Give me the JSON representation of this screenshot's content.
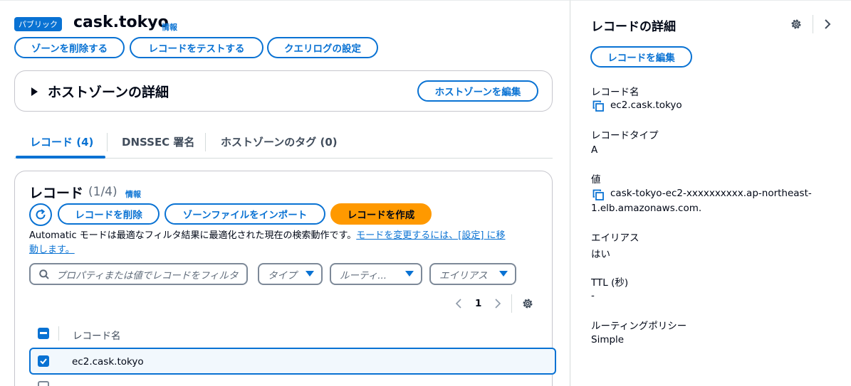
{
  "zone": {
    "badge": "パブリック",
    "name": "cask.tokyo",
    "info": "情報"
  },
  "actions": {
    "delete_zone": "ゾーンを削除する",
    "test_record": "レコードをテストする",
    "query_log": "クエリログの設定"
  },
  "hosted_zone_details": {
    "title": "ホストゾーンの詳細",
    "edit": "ホストゾーンを編集"
  },
  "tabs": [
    {
      "label": "レコード (4)"
    },
    {
      "label": "DNSSEC 署名"
    },
    {
      "label": "ホストゾーンのタグ (0)"
    }
  ],
  "records": {
    "title": "レコード",
    "count": "(1/4)",
    "info": "情報",
    "delete": "レコードを削除",
    "import": "ゾーンファイルをインポート",
    "create": "レコードを作成",
    "notice_text": "Automatic モードは最適なフィルタ結果に最適化された現在の検索動作です。",
    "notice_link_1": "モードを変更するには、[設定] に移",
    "notice_link_2": "動します。",
    "search_placeholder": "プロパティまたは値でレコードをフィルタ",
    "filter_type": "タイプ",
    "filter_routing": "ルーティ...",
    "filter_alias": "エイリアス",
    "page": "1",
    "column_name": "レコード名",
    "rows": [
      {
        "name": "ec2.cask.tokyo",
        "selected": true
      }
    ]
  },
  "details_panel": {
    "title": "レコードの詳細",
    "edit": "レコードを編集",
    "fields": [
      {
        "label": "レコード名",
        "value": "ec2.cask.tokyo"
      },
      {
        "label": "レコードタイプ",
        "value": "A"
      },
      {
        "label": "値",
        "value_1": "cask-tokyo-ec2-xxxxxxxxxx.ap-northeast-",
        "value_2": "1.elb.amazonaws.com."
      },
      {
        "label": "エイリアス",
        "value": "はい"
      },
      {
        "label": "TTL (秒)",
        "value": "-"
      },
      {
        "label": "ルーティングポリシー",
        "value": "Simple"
      }
    ]
  },
  "colors": {
    "accent": "#0972d3",
    "primary": "#ff9900",
    "text": "#000716"
  }
}
